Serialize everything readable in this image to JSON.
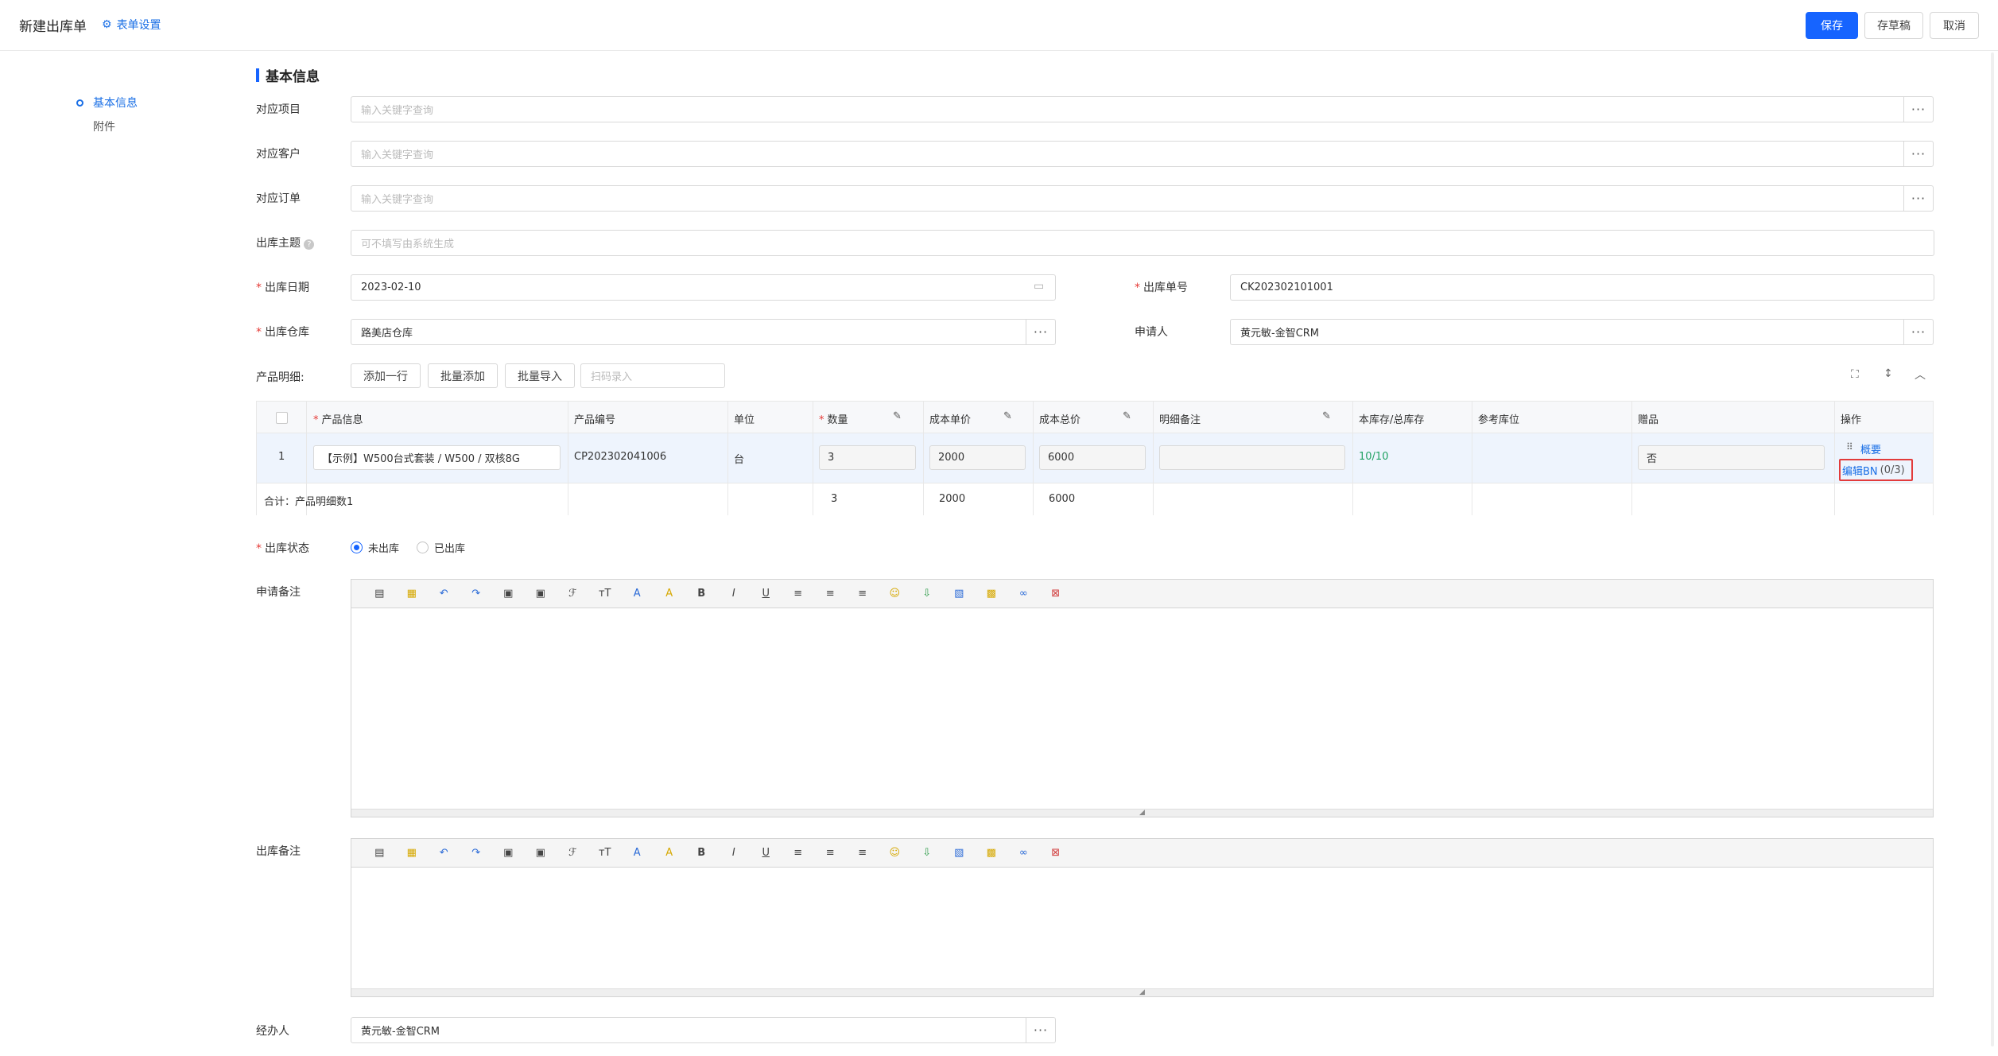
{
  "header": {
    "title": "新建出库单",
    "form_settings": "表单设置",
    "save": "保存",
    "draft": "存草稿",
    "cancel": "取消"
  },
  "nav": [
    "基本信息",
    "附件"
  ],
  "section_title": "基本信息",
  "fields": {
    "project": {
      "label": "对应项目",
      "placeholder": "输入关键字查询"
    },
    "customer": {
      "label": "对应客户",
      "placeholder": "输入关键字查询"
    },
    "order": {
      "label": "对应订单",
      "placeholder": "输入关键字查询"
    },
    "subject": {
      "label": "出库主题",
      "placeholder": "可不填写由系统生成"
    },
    "date": {
      "label": "出库日期",
      "value": "2023-02-10"
    },
    "number": {
      "label": "出库单号",
      "value": "CK202302101001"
    },
    "warehouse": {
      "label": "出库仓库",
      "value": "路美店仓库"
    },
    "applicant": {
      "label": "申请人",
      "value": "黄元敏-金智CRM"
    },
    "handler": {
      "label": "经办人",
      "value": "黄元敏-金智CRM"
    }
  },
  "product_section": {
    "label": "产品明细:",
    "add_row": "添加一行",
    "batch_add": "批量添加",
    "batch_import": "批量导入",
    "scan_placeholder": "扫码录入"
  },
  "table": {
    "headers": [
      "产品信息",
      "产品编号",
      "单位",
      "数量",
      "成本单价",
      "成本总价",
      "明细备注",
      "本库存/总库存",
      "参考库位",
      "赠品",
      "操作"
    ],
    "row": {
      "index": "1",
      "product": "【示例】W500台式套装 / W500 / 双核8G",
      "code": "CP202302041006",
      "unit": "台",
      "qty": "3",
      "unit_cost": "2000",
      "total_cost": "6000",
      "note": "",
      "stock": "10/10",
      "location": "",
      "gift": "否",
      "op_summary": "概要",
      "op_edit_bn": "编辑BN",
      "op_bn_count": "(0/3)"
    },
    "summary": {
      "label": "合计：产品明细数1",
      "qty": "3",
      "unit_cost": "2000",
      "total_cost": "6000"
    }
  },
  "status": {
    "label": "出库状态",
    "opt1": "未出库",
    "opt2": "已出库"
  },
  "apply_note": {
    "label": "申请备注"
  },
  "out_note": {
    "label": "出库备注"
  },
  "colors": {
    "primary": "#1664ff",
    "required": "#e53935",
    "stock": "#20a162",
    "highlight": "#e23b3b"
  }
}
